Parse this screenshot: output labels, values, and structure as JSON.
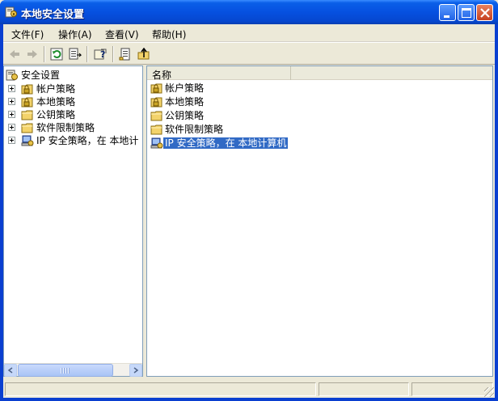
{
  "window": {
    "title": "本地安全设置"
  },
  "menu": [
    {
      "label": "文件(F)"
    },
    {
      "label": "操作(A)"
    },
    {
      "label": "查看(V)"
    },
    {
      "label": "帮助(H)"
    }
  ],
  "toolbar": {
    "buttons": [
      "back-icon",
      "forward-icon",
      "refresh-icon",
      "export-list-icon",
      "help-icon",
      "properties-icon",
      "up-folder-icon"
    ]
  },
  "tree": {
    "root": "安全设置",
    "items": [
      {
        "label": "帐户策略",
        "icon": "locked-folder-icon"
      },
      {
        "label": "本地策略",
        "icon": "locked-folder-icon"
      },
      {
        "label": "公钥策略",
        "icon": "folder-icon"
      },
      {
        "label": "软件限制策略",
        "icon": "folder-icon"
      },
      {
        "label": "IP 安全策略，在 本地计",
        "icon": "ip-security-icon"
      }
    ]
  },
  "list": {
    "column_name": "名称",
    "items": [
      {
        "label": "帐户策略",
        "icon": "locked-folder-icon"
      },
      {
        "label": "本地策略",
        "icon": "locked-folder-icon"
      },
      {
        "label": "公钥策略",
        "icon": "folder-icon"
      },
      {
        "label": "软件限制策略",
        "icon": "folder-icon"
      },
      {
        "label": "IP 安全策略，在 本地计算机",
        "icon": "ip-security-icon",
        "selected": true
      }
    ]
  },
  "colors": {
    "title_bar": "#0650e0",
    "selection": "#316ac5",
    "window_face": "#ece9d8"
  }
}
